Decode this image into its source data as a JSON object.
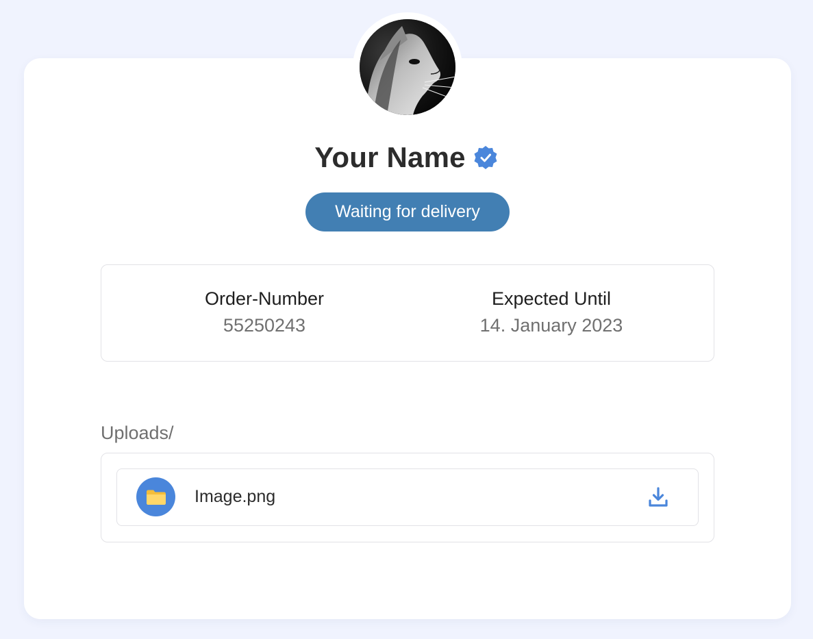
{
  "profile": {
    "name": "Your Name",
    "avatar_icon": "cat-profile-photo",
    "verified_icon": "verified-badge-icon"
  },
  "status": {
    "label": "Waiting for delivery",
    "color": "#427fb3"
  },
  "order": {
    "number_label": "Order-Number",
    "number_value": "55250243",
    "expected_label": "Expected Until",
    "expected_value": "14. January 2023"
  },
  "uploads": {
    "title": "Uploads/",
    "files": [
      {
        "name": "Image.png",
        "icon": "folder-icon",
        "action_icon": "download-icon"
      }
    ]
  },
  "colors": {
    "background": "#f0f3fe",
    "accent": "#4a86db",
    "folder": "#ffd76a"
  }
}
